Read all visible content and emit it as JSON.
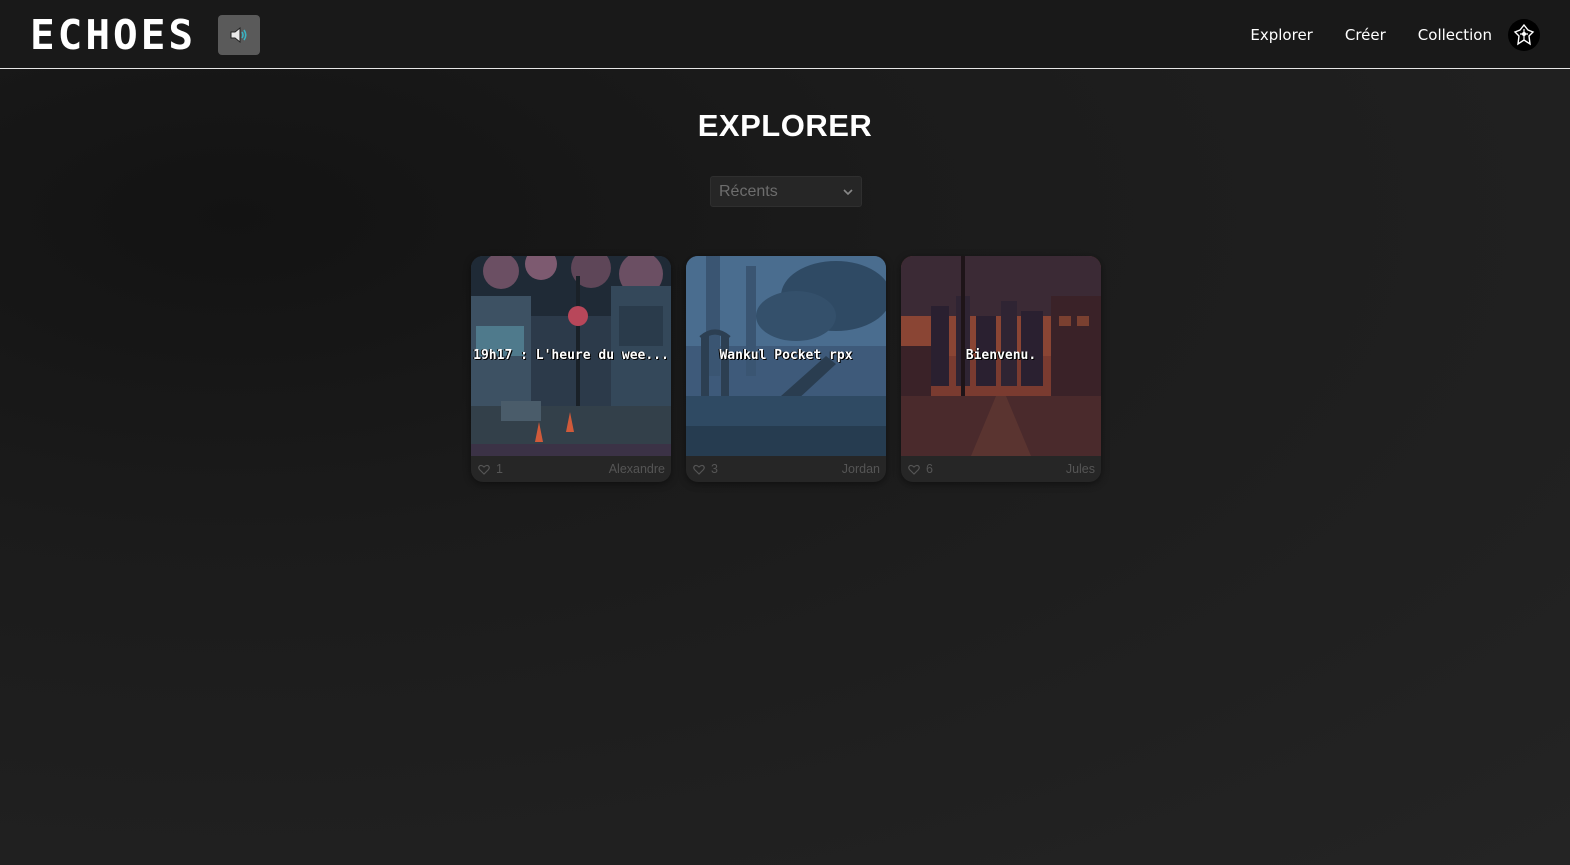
{
  "header": {
    "logo": "ECHOES",
    "nav": [
      "Explorer",
      "Créer",
      "Collection"
    ],
    "accent_color": "#e6e6e6"
  },
  "main": {
    "title": "EXPLORER",
    "sort": {
      "selected": "Récents"
    },
    "cards": [
      {
        "title": "19h17 : L'heure du wee...",
        "likes": "1",
        "author": "Alexandre",
        "scene": "cherry-blossom-street"
      },
      {
        "title": "Wankul Pocket rpx",
        "likes": "3",
        "author": "Jordan",
        "scene": "blue-forest-gate"
      },
      {
        "title": "Bienvenu.",
        "likes": "6",
        "author": "Jules",
        "scene": "sunset-city-street"
      }
    ]
  },
  "icons": {
    "sound": "speaker-icon",
    "like": "heart-outline-icon",
    "avatar": "emblem-icon",
    "select": "chevron-down-icon"
  }
}
